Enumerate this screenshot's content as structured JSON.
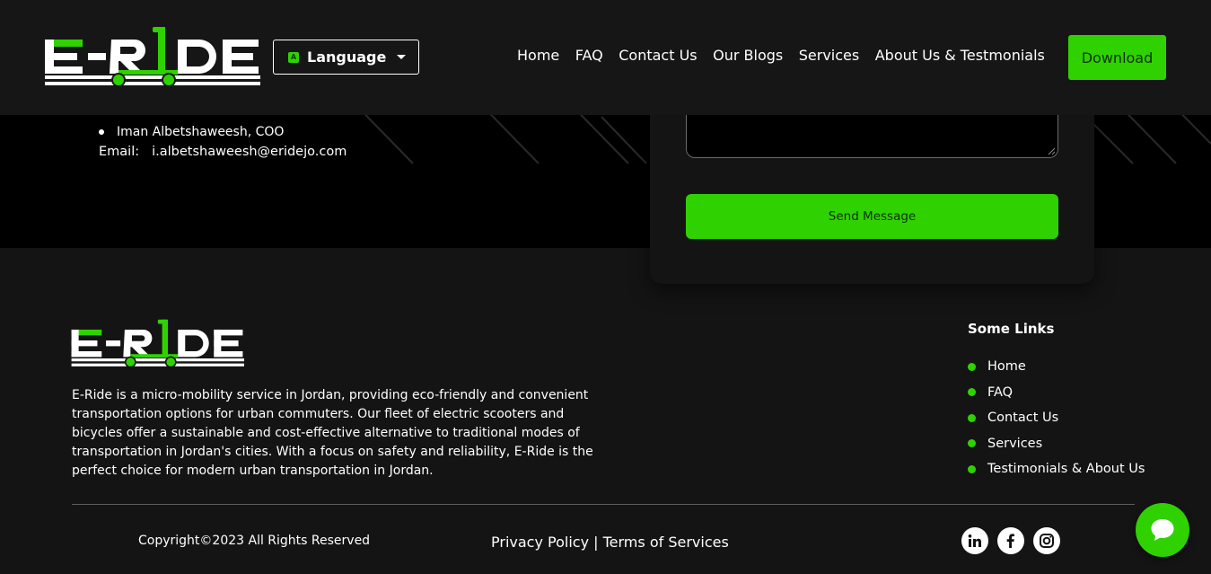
{
  "brand": {
    "name": "E-RIDE",
    "accent": "#2fd200"
  },
  "header": {
    "language_label": "Language",
    "nav": [
      "Home",
      "FAQ",
      "Contact Us",
      "Our Blogs",
      "Services",
      "About Us & Testmonials"
    ],
    "download_label": "Download"
  },
  "contact": {
    "person": "Iman Albetshaweesh, COO",
    "email_label": "Email:",
    "email_value": "i.albetshaweesh@eridejo.com",
    "send_label": "Send Message"
  },
  "footer": {
    "about": "E-Ride is a micro-mobility service in Jordan, providing eco-friendly and convenient transportation options for urban commuters. Our fleet of electric scooters and bicycles offer a sustainable and cost-effective alternative to traditional modes of transportation in Jordan's cities. With a focus on safety and reliability, E-Ride is the perfect choice for modern urban transportation in Jordan.",
    "links_title": "Some Links",
    "links": [
      "Home",
      "FAQ",
      "Contact Us",
      "Services",
      "Testimonials & About Us"
    ],
    "copyright": "Copyright©2023 All Rights Reserved",
    "privacy": "Privacy Policy",
    "separator": " | ",
    "terms": "Terms of Services",
    "socials": [
      "linkedin-icon",
      "facebook-icon",
      "instagram-icon"
    ]
  },
  "chat": {
    "icon": "chat-icon"
  }
}
